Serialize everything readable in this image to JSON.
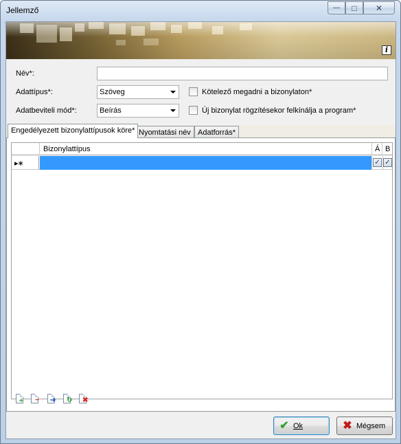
{
  "window": {
    "title": "Jellemző",
    "minimize_symbol": "—",
    "maximize_symbol": "□",
    "close_symbol": "✕"
  },
  "banner": {
    "info_symbol": "i"
  },
  "form": {
    "name_label": "Név*:",
    "name_value": "",
    "datatype_label": "Adattípus*:",
    "datatype_value": "Szöveg",
    "input_mode_label": "Adatbeviteli mód*:",
    "input_mode_value": "Beírás",
    "mandatory_checkbox_label": "Kötelező megadni a bizonylaton*",
    "mandatory_checked": false,
    "offer_checkbox_label": "Új bizonylat rögzítésekor felkínálja a program*",
    "offer_checked": false
  },
  "tabs": [
    {
      "label": "Engedélyezett bizonylattípusok köre*",
      "active": true
    },
    {
      "label": "Nyomtatási név",
      "active": false
    },
    {
      "label": "Adatforrás*",
      "active": false
    }
  ],
  "grid": {
    "columns": [
      "Bizonylattípus",
      "Á",
      "B"
    ],
    "new_row_marker": "▸∗",
    "rows": [
      {
        "bizonylattipus": "",
        "a_checked": true,
        "b_checked": true,
        "selected": true
      }
    ],
    "check_mark": "✓"
  },
  "toolbar": {
    "icons": [
      "add-row-icon",
      "remove-row-icon",
      "move-right-icon",
      "refresh-icon",
      "delete-icon"
    ]
  },
  "buttons": {
    "ok_label": "Ok",
    "cancel_label": "Mégsem"
  },
  "colors": {
    "selection": "#3399ff",
    "ok_icon": "#2fa32f",
    "cancel_icon": "#c21b1b"
  }
}
